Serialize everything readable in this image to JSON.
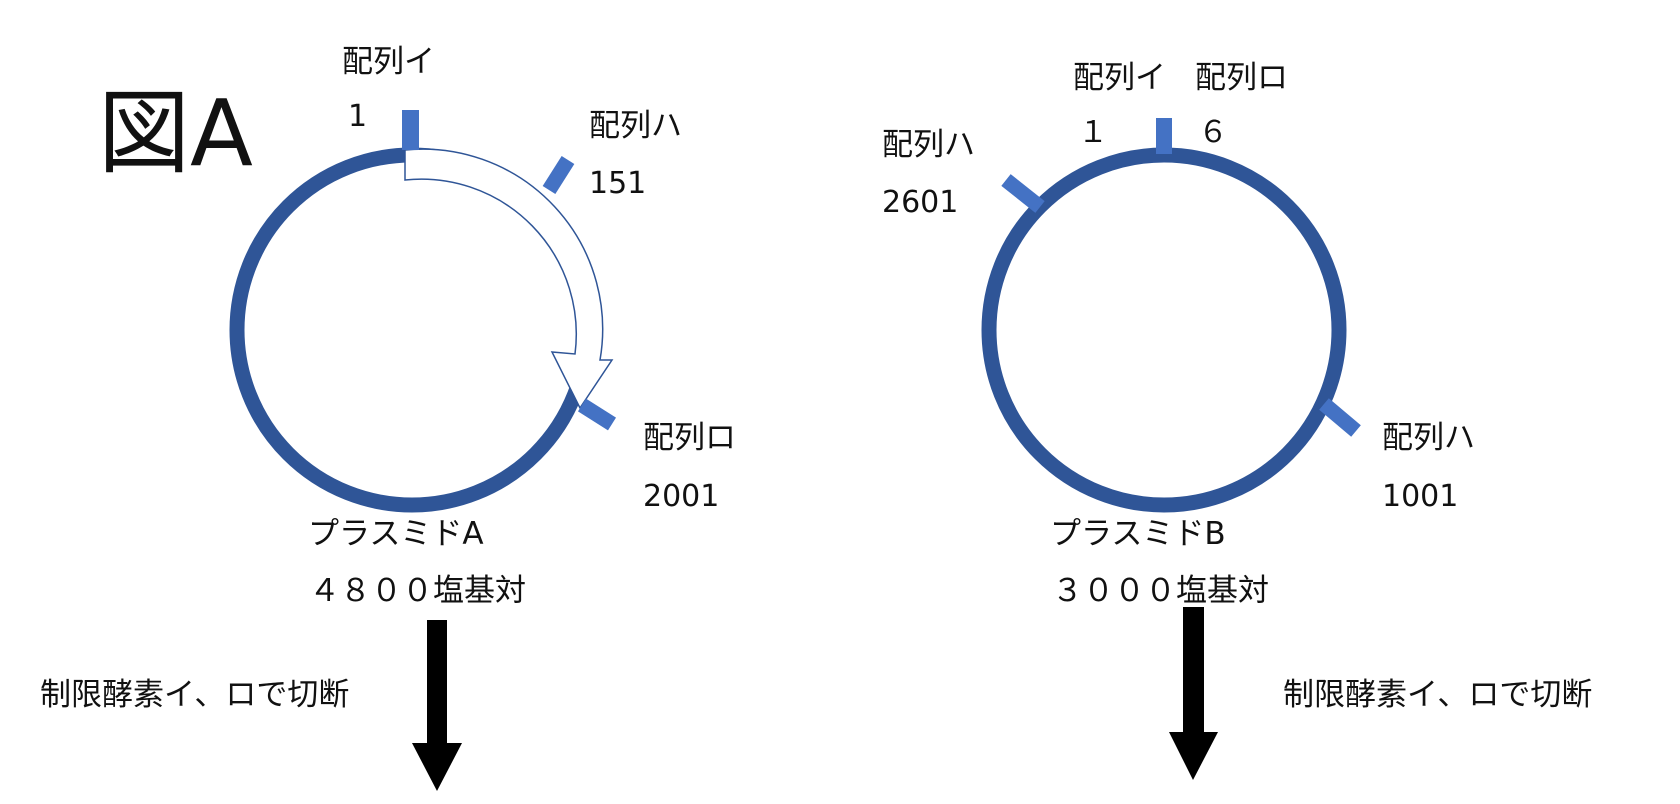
{
  "figure_title": "図A",
  "plasmid_a": {
    "name": "プラスミドA",
    "size": "４８００塩基対",
    "sites": [
      {
        "label": "配列イ",
        "position": "1"
      },
      {
        "label": "配列ハ",
        "position": "151"
      },
      {
        "label": "配列ロ",
        "position": "2001"
      }
    ],
    "action": "制限酵素イ、ロで切断"
  },
  "plasmid_b": {
    "name": "プラスミドB",
    "size": "３０００塩基対",
    "sites": [
      {
        "label": "配列イ",
        "position": "１"
      },
      {
        "label": "配列ロ",
        "position": "６"
      },
      {
        "label": "配列ハ",
        "position": "2601"
      },
      {
        "label": "配列ハ",
        "position": "1001"
      }
    ],
    "action": "制限酵素イ、ロで切断"
  },
  "colors": {
    "ring": "#2f5597",
    "site_marker": "#4472c4",
    "arrow_outline": "#2f5597",
    "down_arrow": "#000000"
  }
}
